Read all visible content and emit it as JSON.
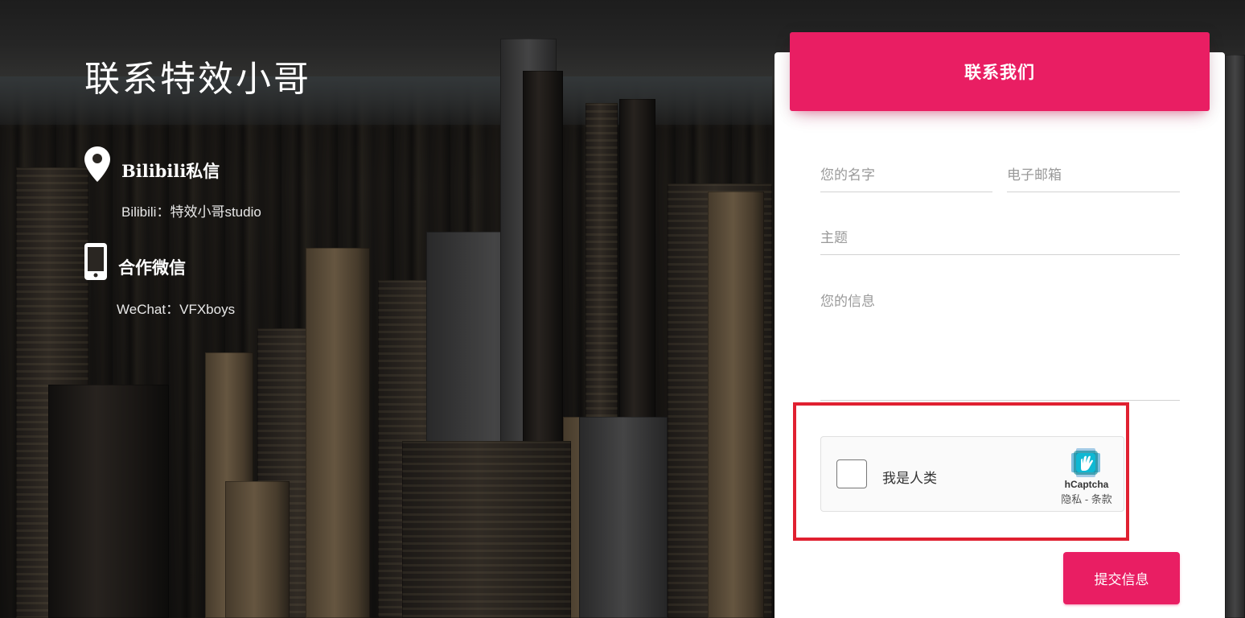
{
  "site_title": "联系特效小哥",
  "contacts": [
    {
      "icon": "map-pin-icon",
      "heading": "Bilibili私信",
      "text": "Bilibili：特效小哥studio"
    },
    {
      "icon": "mobile-phone-icon",
      "heading": "合作微信",
      "text": "WeChat：VFXboys"
    }
  ],
  "form": {
    "header": "联系我们",
    "name_placeholder": "您的名字",
    "email_placeholder": "电子邮箱",
    "subject_placeholder": "主题",
    "message_placeholder": "您的信息",
    "captcha": {
      "label": "我是人类",
      "brand": "hCaptcha",
      "links": "隐私 - 条款"
    },
    "submit_label": "提交信息"
  },
  "colors": {
    "accent": "#e91e63",
    "highlight_border": "#e02030"
  }
}
